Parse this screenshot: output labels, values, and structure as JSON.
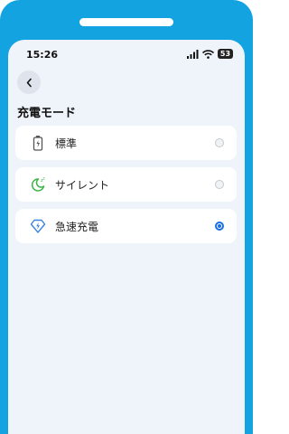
{
  "status_bar": {
    "time": "15:26",
    "battery_level": "53",
    "icons": [
      "signal-icon",
      "wifi-icon",
      "battery-icon"
    ]
  },
  "header": {
    "back_icon": "chevron-left-icon",
    "title": "充電モード"
  },
  "options": [
    {
      "label": "標準",
      "icon": "battery-icon",
      "selected": false
    },
    {
      "label": "サイレント",
      "icon": "moon-icon",
      "selected": false
    },
    {
      "label": "急速充電",
      "icon": "fast-charge-icon",
      "selected": true
    }
  ],
  "colors": {
    "frame": "#14a3e1",
    "screen_bg": "#eff3fa",
    "accent": "#1a6fe0",
    "silent_icon": "#3cb54a",
    "fast_icon": "#3d82e0"
  }
}
